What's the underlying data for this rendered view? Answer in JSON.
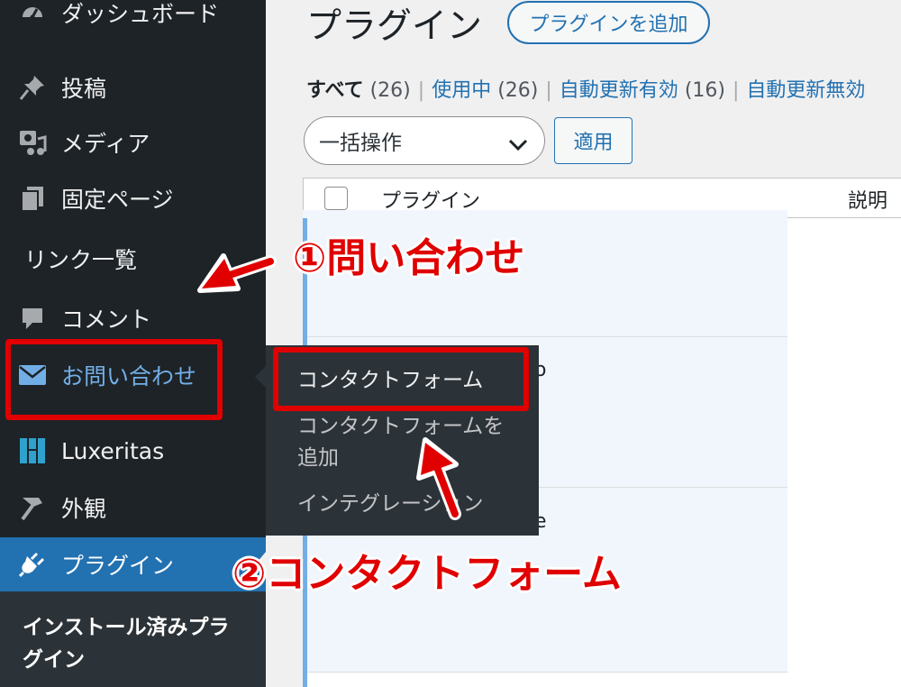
{
  "sidebar": {
    "items": [
      {
        "label": "ダッシュボード",
        "icon": "dashboard-icon"
      },
      {
        "label": "投稿",
        "icon": "pin-icon"
      },
      {
        "label": "メディア",
        "icon": "media-icon"
      },
      {
        "label": "固定ページ",
        "icon": "pages-icon"
      },
      {
        "label": "リンク一覧"
      },
      {
        "label": "コメント",
        "icon": "comment-icon"
      },
      {
        "label": "お問い合わせ",
        "icon": "mail-icon"
      },
      {
        "label": "Luxeritas",
        "icon": "luxeritas-icon"
      },
      {
        "label": "外観",
        "icon": "appearance-icon"
      },
      {
        "label": "プラグイン",
        "icon": "plugin-icon"
      }
    ],
    "current_submenu": "インストール済みプラグイン"
  },
  "flyout": {
    "items": [
      "コンタクトフォーム",
      "コンタクトフォームを追加",
      "インテグレーション"
    ]
  },
  "main": {
    "title": "プラグイン",
    "add_button": "プラグインを追加",
    "filters": {
      "all": "すべて",
      "all_count": "(26)",
      "active": "使用中",
      "active_count": "(26)",
      "auto_on": "自動更新有効",
      "auto_on_count": "(16)",
      "auto_off": "自動更新無効"
    },
    "bulk_select": "一括操作",
    "apply_button": "適用",
    "columns": {
      "plugin": "プラグイン",
      "description": "説明"
    },
    "partial_text": {
      "row_a": "o",
      "row_b": "e"
    }
  },
  "annotations": {
    "step1": "①問い合わせ",
    "step2": "②コンタクトフォーム",
    "color": "#e00000"
  },
  "colors": {
    "sidebar_bg": "#1d2327",
    "accent": "#2271b1",
    "hover_text": "#72aee6",
    "flyout_bg": "#2c3338"
  }
}
